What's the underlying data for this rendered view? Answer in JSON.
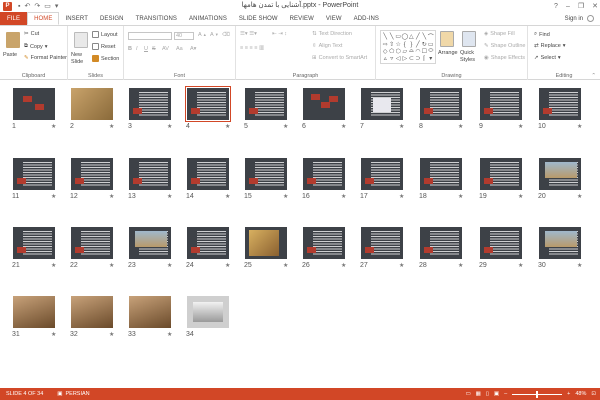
{
  "window": {
    "title": "آشنایی با تمدن هامها.pptx - PowerPoint",
    "controls": [
      "?",
      "–",
      "❐",
      "✕"
    ]
  },
  "tabs": [
    "FILE",
    "HOME",
    "INSERT",
    "DESIGN",
    "TRANSITIONS",
    "ANIMATIONS",
    "SLIDE SHOW",
    "REVIEW",
    "VIEW",
    "ADD-INS"
  ],
  "active_tab": "HOME",
  "signin": "Sign in",
  "ribbon": {
    "clipboard": {
      "paste": "Paste",
      "cut": "Cut",
      "copy": "Copy",
      "format_painter": "Format Painter",
      "label": "Clipboard"
    },
    "slides": {
      "new_slide": "New Slide",
      "layout": "Layout",
      "reset": "Reset",
      "section": "Section",
      "label": "Slides"
    },
    "font": {
      "size": "40",
      "bold": "B",
      "italic": "I",
      "underline": "U",
      "strike": "S",
      "label": "Font"
    },
    "paragraph": {
      "text_direction": "Text Direction",
      "align_text": "Align Text",
      "convert": "Convert to SmartArt",
      "label": "Paragraph"
    },
    "drawing": {
      "arrange": "Arrange",
      "quick_styles": "Quick Styles",
      "shape_fill": "Shape Fill",
      "shape_outline": "Shape Outline",
      "shape_effects": "Shape Effects",
      "label": "Drawing"
    },
    "editing": {
      "find": "Find",
      "replace": "Replace",
      "select": "Select",
      "label": "Editing"
    }
  },
  "slides": [
    {
      "n": "1",
      "kind": "title"
    },
    {
      "n": "2",
      "kind": "map"
    },
    {
      "n": "3",
      "kind": "text"
    },
    {
      "n": "4",
      "kind": "text"
    },
    {
      "n": "5",
      "kind": "text"
    },
    {
      "n": "6",
      "kind": "red"
    },
    {
      "n": "7",
      "kind": "text-img"
    },
    {
      "n": "8",
      "kind": "text"
    },
    {
      "n": "9",
      "kind": "text"
    },
    {
      "n": "10",
      "kind": "text"
    },
    {
      "n": "11",
      "kind": "text"
    },
    {
      "n": "12",
      "kind": "text"
    },
    {
      "n": "13",
      "kind": "text"
    },
    {
      "n": "14",
      "kind": "text"
    },
    {
      "n": "15",
      "kind": "text"
    },
    {
      "n": "16",
      "kind": "text"
    },
    {
      "n": "17",
      "kind": "text"
    },
    {
      "n": "18",
      "kind": "text"
    },
    {
      "n": "19",
      "kind": "text"
    },
    {
      "n": "20",
      "kind": "photo"
    },
    {
      "n": "21",
      "kind": "text"
    },
    {
      "n": "22",
      "kind": "text"
    },
    {
      "n": "23",
      "kind": "photo"
    },
    {
      "n": "24",
      "kind": "text"
    },
    {
      "n": "25",
      "kind": "photo-gold"
    },
    {
      "n": "26",
      "kind": "text"
    },
    {
      "n": "27",
      "kind": "text"
    },
    {
      "n": "28",
      "kind": "text"
    },
    {
      "n": "29",
      "kind": "text"
    },
    {
      "n": "30",
      "kind": "photo"
    },
    {
      "n": "31",
      "kind": "photo-full"
    },
    {
      "n": "32",
      "kind": "photo-full"
    },
    {
      "n": "33",
      "kind": "photo-full"
    },
    {
      "n": "34",
      "kind": "laptop"
    }
  ],
  "selected_slide": "4",
  "star": "★",
  "status": {
    "slide": "SLIDE 4 OF 34",
    "language": "PERSIAN",
    "zoom": "48%",
    "zoom_fraction": 0.48
  },
  "colors": {
    "accent": "#d24726",
    "thumb_bg": "#3d4147"
  }
}
